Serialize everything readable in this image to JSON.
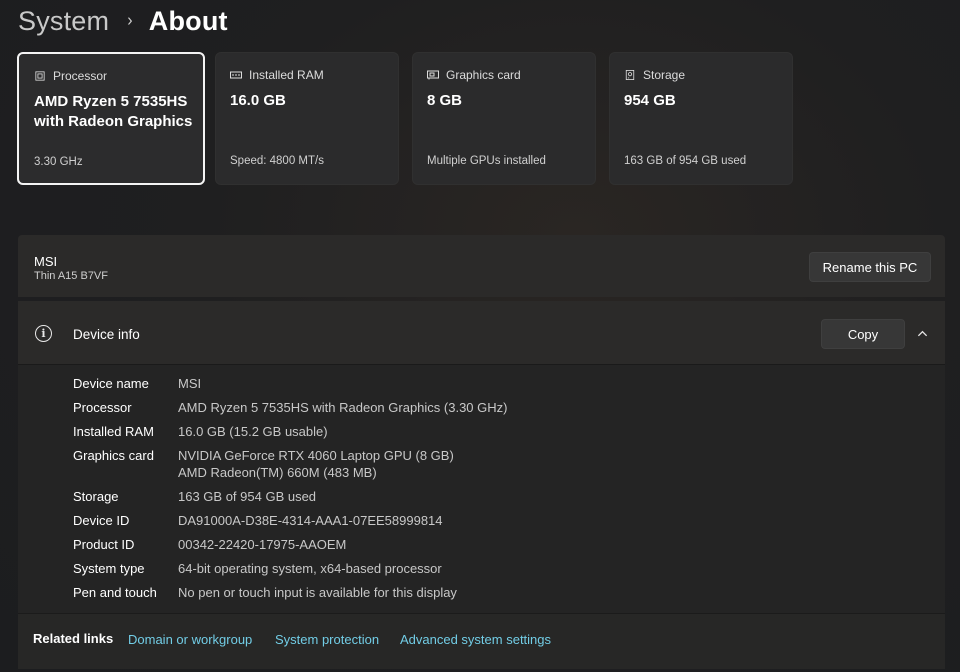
{
  "breadcrumb": {
    "parent": "System",
    "separator": "›",
    "current": "About"
  },
  "cards": [
    {
      "label": "Processor",
      "icon": "processor-icon",
      "value": "AMD Ryzen 5 7535HS with Radeon Graphics",
      "sub": "3.30 GHz",
      "selected": true
    },
    {
      "label": "Installed RAM",
      "icon": "memory-icon",
      "value": "16.0 GB",
      "sub": "Speed: 4800 MT/s",
      "selected": false
    },
    {
      "label": "Graphics card",
      "icon": "graphics-card-icon",
      "value": "8 GB",
      "sub": "Multiple GPUs installed",
      "selected": false
    },
    {
      "label": "Storage",
      "icon": "storage-icon",
      "value": "954 GB",
      "sub": "163 GB of 954 GB used",
      "selected": false
    }
  ],
  "pc": {
    "name": "MSI",
    "model": "Thin A15 B7VF",
    "rename_label": "Rename this PC"
  },
  "device_info": {
    "title": "Device info",
    "copy_label": "Copy",
    "rows": [
      {
        "label": "Device name",
        "value": "MSI"
      },
      {
        "label": "Processor",
        "value": "AMD Ryzen 5 7535HS with Radeon Graphics (3.30 GHz)"
      },
      {
        "label": "Installed RAM",
        "value": "16.0 GB (15.2 GB usable)"
      },
      {
        "label": "Graphics card",
        "value": "NVIDIA GeForce RTX 4060 Laptop GPU (8 GB)",
        "value2": "AMD Radeon(TM) 660M (483 MB)"
      },
      {
        "label": "Storage",
        "value": "163 GB of 954 GB used"
      },
      {
        "label": "Device ID",
        "value": "DA91000A-D38E-4314-AAA1-07EE58999814"
      },
      {
        "label": "Product ID",
        "value": "00342-22420-17975-AAOEM"
      },
      {
        "label": "System type",
        "value": "64-bit operating system, x64-based processor"
      },
      {
        "label": "Pen and touch",
        "value": "No pen or touch input is available for this display"
      }
    ]
  },
  "related_links": {
    "label": "Related links",
    "links": [
      "Domain or workgroup",
      "System protection",
      "Advanced system settings"
    ]
  },
  "colors": {
    "link": "#72cde6",
    "panel": "#2b2a29",
    "background": "#202020"
  }
}
